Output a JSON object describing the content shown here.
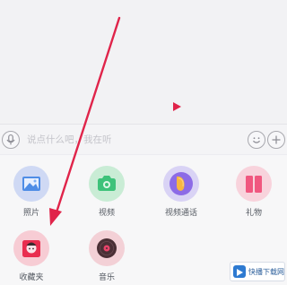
{
  "composer": {
    "placeholder": "说点什么吧，我在听",
    "voice_icon": "microphone-icon",
    "emoji_icon": "emoji-icon",
    "plus_icon": "plus-icon"
  },
  "panel": {
    "items": [
      {
        "label": "照片",
        "icon": "photo-icon",
        "color": "#cfd9f4"
      },
      {
        "label": "视频",
        "icon": "video-camera-icon",
        "color": "#c9ecd5"
      },
      {
        "label": "视频通话",
        "icon": "video-call-icon",
        "color": "#d9d3f5"
      },
      {
        "label": "礼物",
        "icon": "gift-icon",
        "color": "#f8d3dc"
      },
      {
        "label": "收藏夹",
        "icon": "favorites-folder-icon",
        "color": "#f7ccd4"
      },
      {
        "label": "音乐",
        "icon": "music-disc-icon",
        "color": "#f3d0d6"
      }
    ]
  },
  "annotation": {
    "color": "#e0244a"
  },
  "watermark": {
    "text": "快播下载网"
  }
}
